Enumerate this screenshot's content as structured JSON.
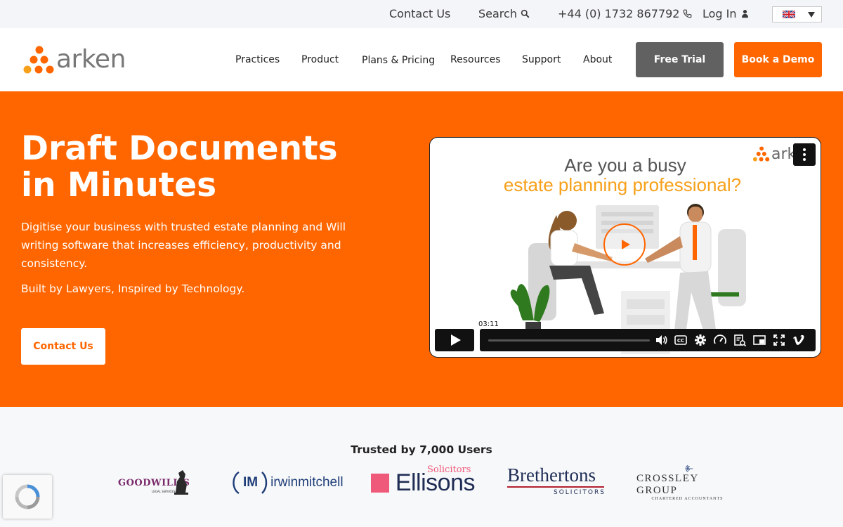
{
  "topbar": {
    "contact": "Contact Us",
    "search": "Search",
    "phone": "+44 (0) 1732 867792",
    "login": "Log In",
    "language": "UK flag"
  },
  "header": {
    "logo_text": "arken",
    "nav": [
      "Practices",
      "Product",
      "Plans & Pricing",
      "Resources",
      "Support",
      "About"
    ],
    "free_trial": "Free Trial",
    "book_demo": "Book a Demo"
  },
  "hero": {
    "title": "Draft Documents in Minutes",
    "description": "Digitise your business with trusted estate planning and Will writing software that increases efficiency, productivity and consistency.",
    "tagline": "Built by Lawyers, Inspired by Technology.",
    "cta": "Contact Us"
  },
  "video": {
    "line1": "Are you a busy",
    "line2": "estate planning professional?",
    "logo_text": "ark",
    "duration": "03:11",
    "progress": 0.0
  },
  "trusted": {
    "title": "Trusted by 7,000 Users",
    "logos": {
      "goodwills": "GOODWILL'S",
      "goodwills_sub": "LEGAL SERVICES LTD",
      "irwin_im": "IM",
      "irwin": "irwinmitchell",
      "ellisons": "Ellisons",
      "ellisons_sub": "Solicitors",
      "brethertons": "Brethertons",
      "brethertons_sub": "SOLICITORS",
      "crossley": "CROSSLEY GROUP",
      "crossley_sub": "CHARTERED ACCOUNTANTS"
    }
  },
  "colors": {
    "brand": "#ff6600",
    "trial_button": "#616161",
    "topbar_bg": "#f4f5f9"
  }
}
